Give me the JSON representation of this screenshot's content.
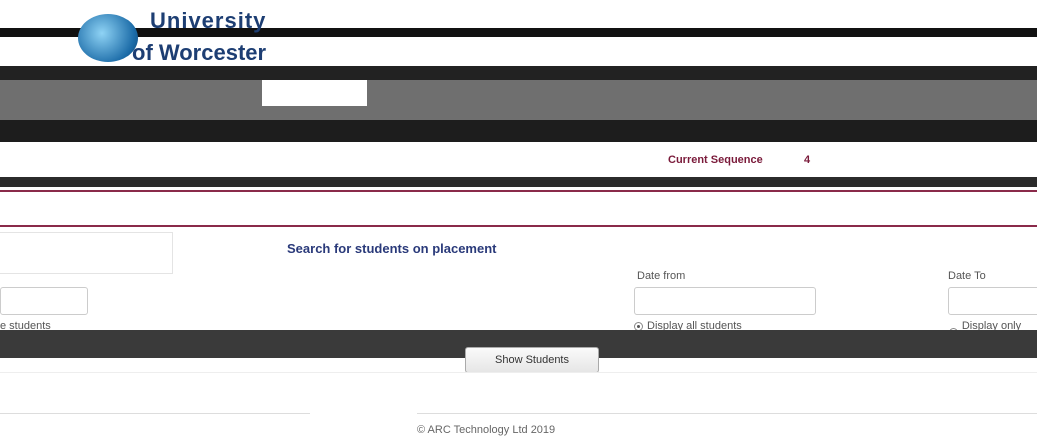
{
  "header": {
    "logo_line1": "University",
    "logo_line2": "of Worcester"
  },
  "placement": {
    "current_sequence_label": "Current Sequence",
    "current_sequence_value": "4"
  },
  "search": {
    "title": "Search for students on placement",
    "date_from_label": "Date from",
    "date_to_label": "Date To",
    "left_students_label": "e students",
    "radio_all_label": "Display all students",
    "radio_active_label": "Display only act",
    "show_button_label": "Show Students"
  },
  "footer": {
    "copyright": "© ARC Technology Ltd 2019"
  },
  "colors": {
    "accent": "#8a2a4a",
    "title": "#2a3a7a",
    "brand": "#1d3e73"
  }
}
